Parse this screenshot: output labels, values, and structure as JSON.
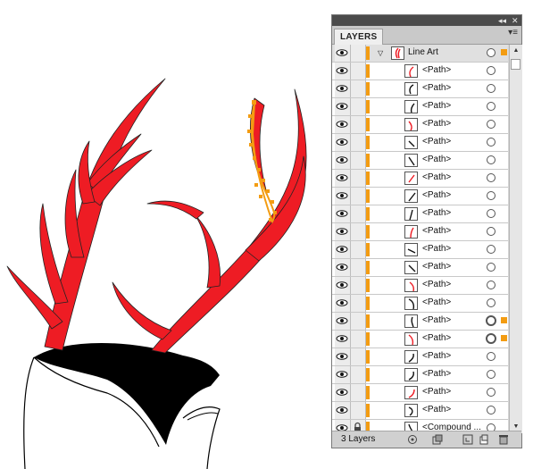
{
  "panel": {
    "tab_label": "LAYERS",
    "collapse_glyph": "◂◂",
    "close_glyph": "✕",
    "menu_glyph": "▾≡",
    "layer_count": "3 Layers"
  },
  "colors": {
    "antler_fill": "#ee1c24",
    "selection": "#f39c12",
    "layer_color": "#f39c12"
  },
  "layer": {
    "name": "Line Art",
    "expand_glyph": "▽"
  },
  "rows": [
    {
      "name": "<Path>"
    },
    {
      "name": "<Path>"
    },
    {
      "name": "<Path>"
    },
    {
      "name": "<Path>"
    },
    {
      "name": "<Path>"
    },
    {
      "name": "<Path>"
    },
    {
      "name": "<Path>"
    },
    {
      "name": "<Path>"
    },
    {
      "name": "<Path>"
    },
    {
      "name": "<Path>"
    },
    {
      "name": "<Path>"
    },
    {
      "name": "<Path>"
    },
    {
      "name": "<Path>"
    },
    {
      "name": "<Path>"
    },
    {
      "name": "<Path>",
      "selected": true
    },
    {
      "name": "<Path>",
      "selected": true
    },
    {
      "name": "<Path>"
    },
    {
      "name": "<Path>"
    },
    {
      "name": "<Path>"
    },
    {
      "name": "<Path>"
    },
    {
      "name": "<Compound ..."
    }
  ]
}
